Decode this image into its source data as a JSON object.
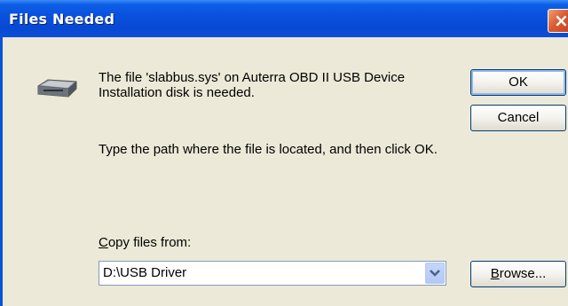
{
  "window": {
    "title": "Files Needed",
    "close_glyph": "×"
  },
  "message": {
    "line1": "The file 'slabbus.sys' on Auterra OBD II USB Device Installation disk is needed.",
    "line2": "Type the path where the file is located, and then click OK."
  },
  "buttons": {
    "ok": "OK",
    "cancel": "Cancel",
    "browse_mnemonic": "B",
    "browse_rest": "rowse..."
  },
  "copy_from": {
    "label_mnemonic": "C",
    "label_rest": "opy files from:",
    "value": "D:\\USB Driver"
  },
  "icons": {
    "disk": "disk-drive-icon",
    "dropdown": "chevron-down-icon"
  },
  "colors": {
    "titlebar": "#0a52de",
    "dialog_bg": "#ece9d8",
    "close": "#d85a32"
  }
}
